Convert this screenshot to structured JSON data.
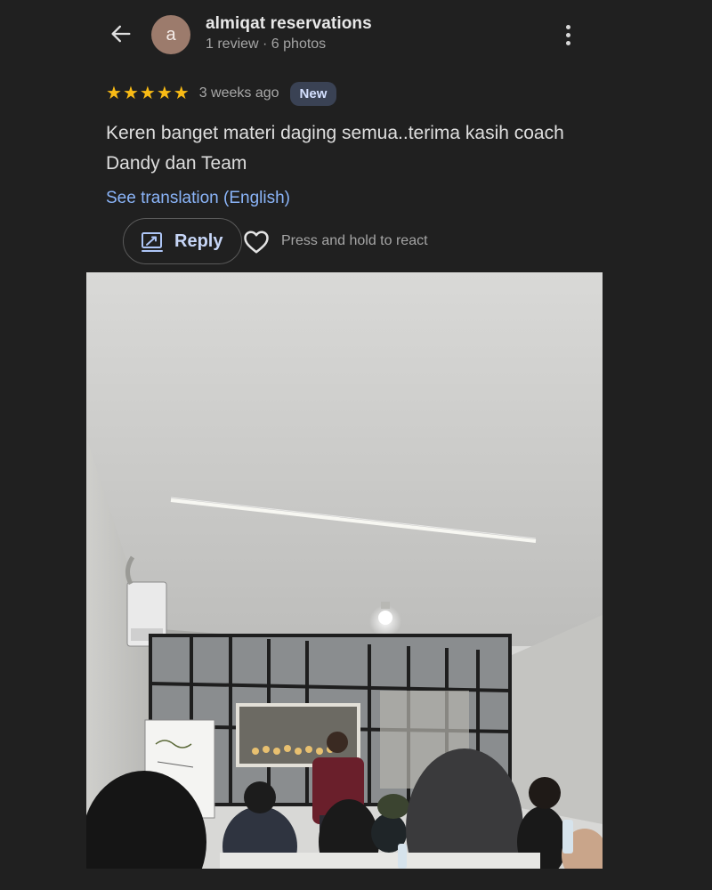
{
  "header": {
    "avatar_letter": "a",
    "reviewer_name": "almiqat reservations",
    "reviewer_meta": "1 review · 6 photos",
    "back_icon": "arrow-left-icon",
    "more_icon": "more-vert-icon"
  },
  "review": {
    "rating": 5,
    "star_glyph": "★",
    "time_ago": "3 weeks ago",
    "badge": "New",
    "text": "Keren banget materi daging semua..terima kasih coach Dandy dan Team",
    "translation_link": "See translation (English)"
  },
  "actions": {
    "reply_label": "Reply",
    "react_hint": "Press and hold to react"
  },
  "colors": {
    "background": "#202020",
    "star": "#f9bb15",
    "link": "#8ab4f8",
    "badge_bg": "#3a4254",
    "avatar_bg": "#9c7b6c"
  }
}
